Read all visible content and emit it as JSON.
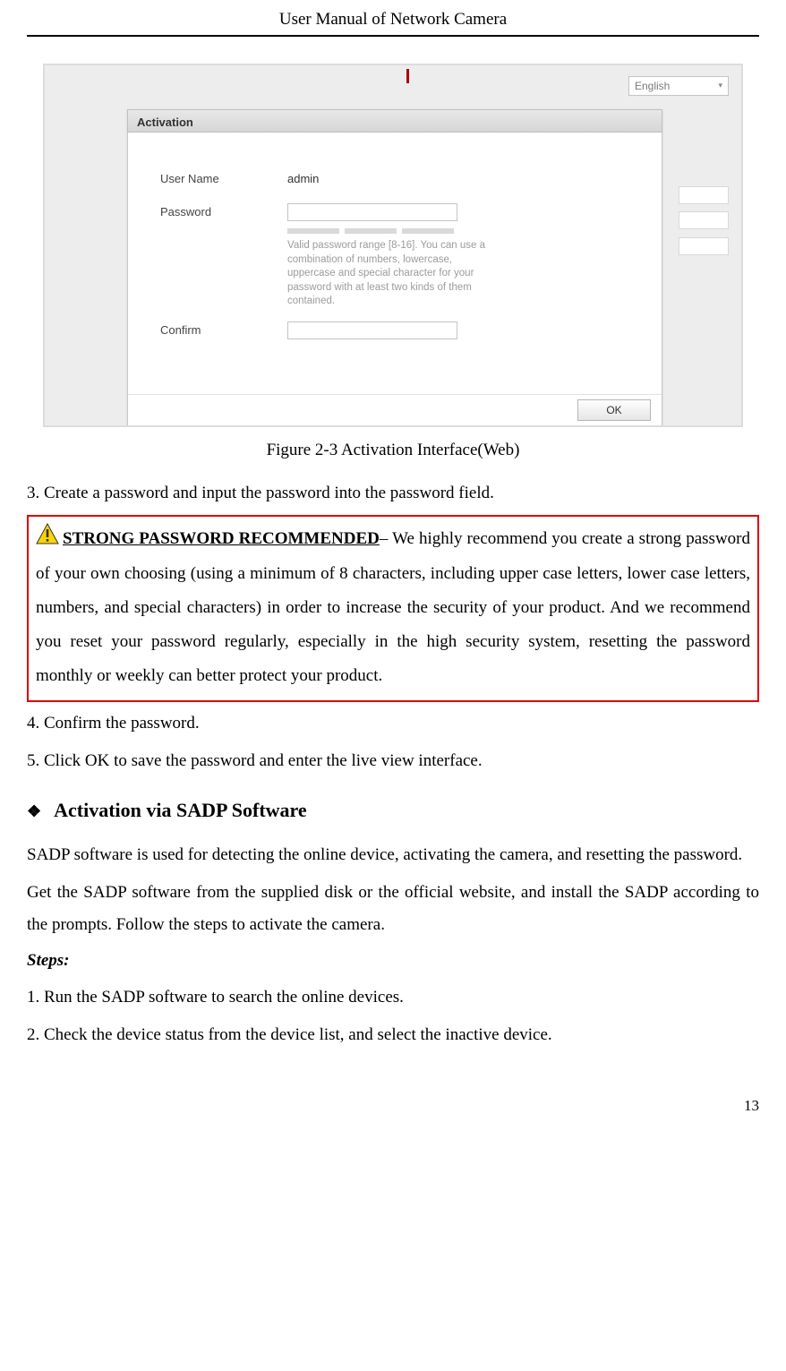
{
  "header": {
    "title": "User Manual of Network Camera"
  },
  "ui": {
    "language": "English",
    "dialog_title": "Activation",
    "labels": {
      "username": "User Name",
      "password": "Password",
      "confirm": "Confirm"
    },
    "username_value": "admin",
    "hint": "Valid password range [8-16]. You can use a combination of numbers, lowercase, uppercase and special character for your password with at least two kinds of them contained.",
    "ok": "OK"
  },
  "figure_caption": "Figure 2-3 Activation Interface(Web)",
  "step3": "3. Create a password and input the password into the password field.",
  "warning": {
    "heading": "STRONG PASSWORD RECOMMENDED",
    "body": "– We highly recommend you create a strong password of your own choosing (using a minimum of 8 characters, including upper case letters, lower case letters, numbers, and special characters) in order to increase the security of your product. And we recommend you reset your password regularly, especially in the high security system, resetting the password monthly or weekly can better protect your product."
  },
  "step4": "4. Confirm the password.",
  "step5": "5. Click OK to save the password and enter the live view interface.",
  "section_title": "Activation via SADP Software",
  "para1": "SADP software is used for detecting the online device, activating the camera, and resetting the password.",
  "para2": "Get the SADP software from the supplied disk or the official website, and install the SADP according to the prompts. Follow the steps to activate the camera.",
  "steps_label": "Steps:",
  "s1": "1. Run the SADP software to search the online devices.",
  "s2": "2. Check the device status from the device list, and select the inactive device.",
  "page_number": "13"
}
